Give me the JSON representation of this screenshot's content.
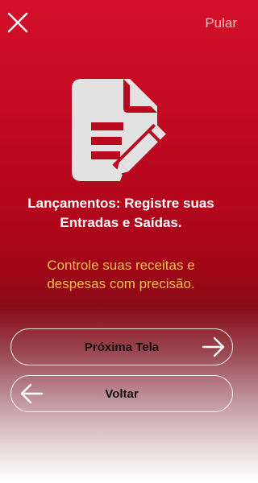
{
  "header": {
    "close_icon": "close-icon",
    "skip_label": "Pular"
  },
  "illustration": {
    "icon": "document-edit-icon",
    "color": "#e2e2e2"
  },
  "content": {
    "title_line1": "Lançamentos: Registre suas",
    "title_line2": "Entradas e Saídas.",
    "subtitle_line1": "Controle suas receitas e",
    "subtitle_line2": "despesas com precisão."
  },
  "buttons": {
    "next_label": "Próxima Tela",
    "next_icon": "arrow-right-icon",
    "back_label": "Voltar",
    "back_icon": "arrow-left-icon"
  },
  "colors": {
    "primary": "#c40a22",
    "subtitle_text": "#f4c24d",
    "title_text": "#ffffff"
  }
}
